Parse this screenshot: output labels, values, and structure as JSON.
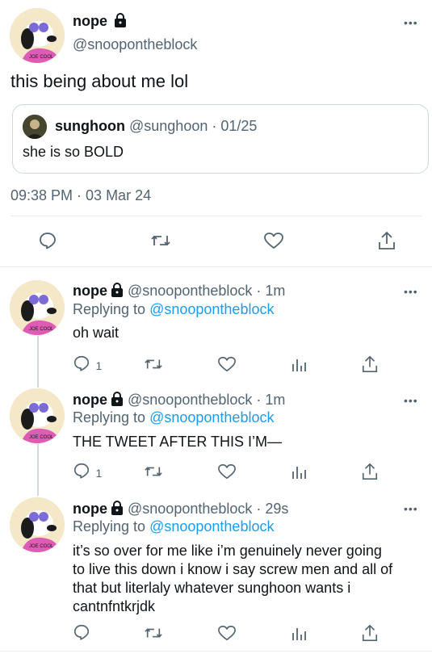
{
  "main_tweet": {
    "name": "nope",
    "handle": "@snoopontheblock",
    "text": "this being about me lol",
    "more": "•••",
    "quote": {
      "name": "sunghoon",
      "handle": "@sunghoon",
      "date": "· 01/25",
      "text": "she is so BOLD"
    },
    "timestamp": "09:38 PM · 03 Mar 24"
  },
  "replies": [
    {
      "name": "nope",
      "meta": "@snoopontheblock · 1m",
      "replying_prefix": "Replying to",
      "replying_handle": "@snoopontheblock",
      "text": "oh wait",
      "reply_count": "1",
      "more": "•••"
    },
    {
      "name": "nope",
      "meta": "@snoopontheblock · 1m",
      "replying_prefix": "Replying to",
      "replying_handle": "@snoopontheblock",
      "text": "THE TWEET AFTER THIS I’M—",
      "reply_count": "1",
      "more": "•••"
    },
    {
      "name": "nope",
      "meta": "@snoopontheblock · 29s",
      "replying_prefix": "Replying to",
      "replying_handle": "@snoopontheblock",
      "text_lines": [
        "it’s so over for me like i’m genuinely never going",
        "to live this down i know i say screw men and all of",
        "that but literlaly whatever sunghoon wants i",
        "cantnfntkrjdk"
      ],
      "reply_count": "",
      "more": "•••"
    }
  ],
  "avatar_badge_text": "JOE COOL",
  "colors": {
    "link": "#1d9bf0",
    "secondary": "#536471",
    "divider": "#e6ecf0"
  }
}
